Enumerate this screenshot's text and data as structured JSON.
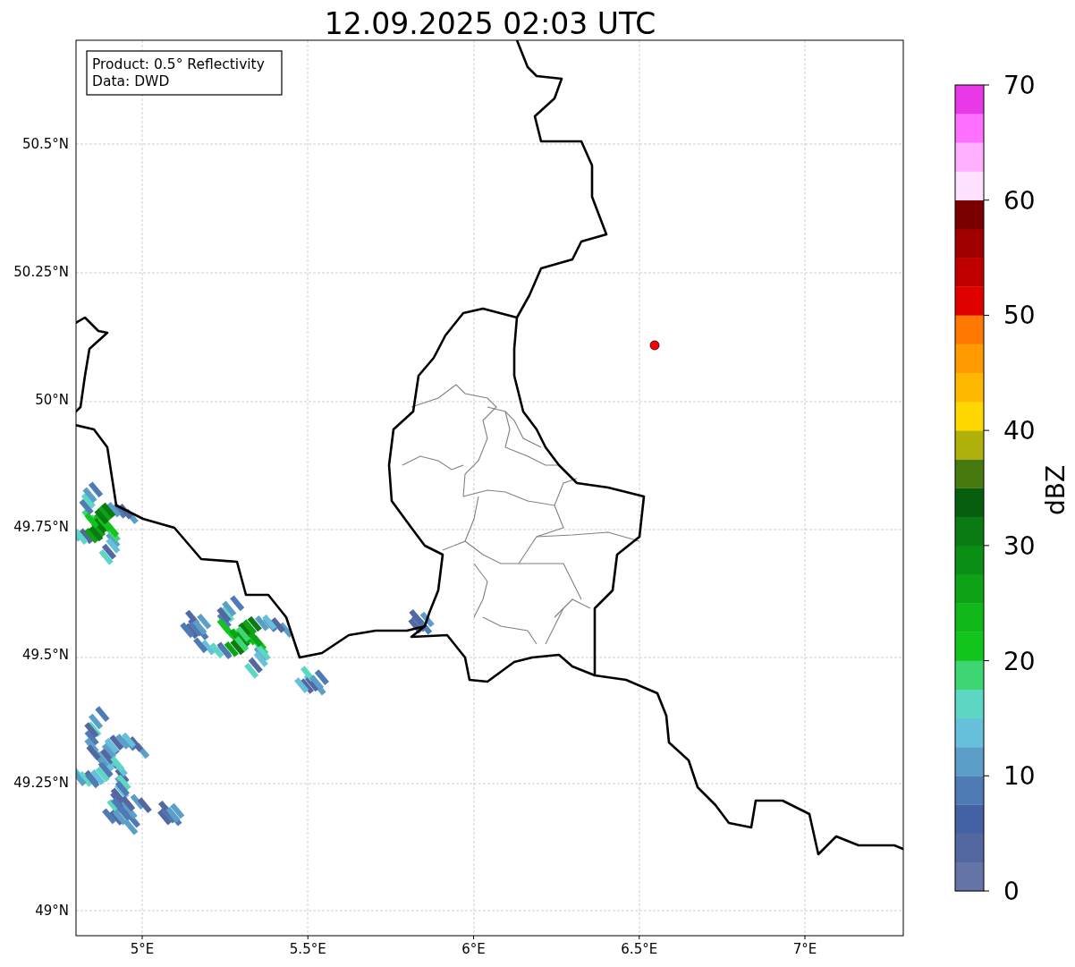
{
  "title": "12.09.2025 02:03 UTC",
  "info_box": [
    "Product: 0.5° Reflectivity",
    "Data: DWD"
  ],
  "x_axis": {
    "ticks": [
      "5°E",
      "5.5°E",
      "6°E",
      "6.5°E",
      "7°E"
    ]
  },
  "y_axis": {
    "ticks": [
      "50.5°N",
      "50.25°N",
      "50°N",
      "49.75°N",
      "49.5°N",
      "49.25°N",
      "49°N"
    ]
  },
  "colorbar": {
    "label": "dBZ",
    "ticks": [
      "70",
      "60",
      "50",
      "40",
      "30",
      "20",
      "10",
      "0"
    ],
    "bins": [
      {
        "color": "#6474a6"
      },
      {
        "color": "#5368a0"
      },
      {
        "color": "#4461a4"
      },
      {
        "color": "#4f7bb5"
      },
      {
        "color": "#5b9ec8"
      },
      {
        "color": "#66c0dc"
      },
      {
        "color": "#5dd6c4"
      },
      {
        "color": "#3dd672"
      },
      {
        "color": "#12c51c"
      },
      {
        "color": "#10b81a"
      },
      {
        "color": "#0ea317"
      },
      {
        "color": "#0b8e14"
      },
      {
        "color": "#0a7a12"
      },
      {
        "color": "#075e0f"
      },
      {
        "color": "#467a0e"
      },
      {
        "color": "#b0b00b"
      },
      {
        "color": "#ffd700"
      },
      {
        "color": "#ffb800"
      },
      {
        "color": "#ff9a00"
      },
      {
        "color": "#ff7800"
      },
      {
        "color": "#e00000"
      },
      {
        "color": "#c00000"
      },
      {
        "color": "#a00000"
      },
      {
        "color": "#7a0000"
      },
      {
        "color": "#ffe0ff"
      },
      {
        "color": "#ffb0ff"
      },
      {
        "color": "#ff70ff"
      },
      {
        "color": "#e838e8"
      }
    ]
  }
}
